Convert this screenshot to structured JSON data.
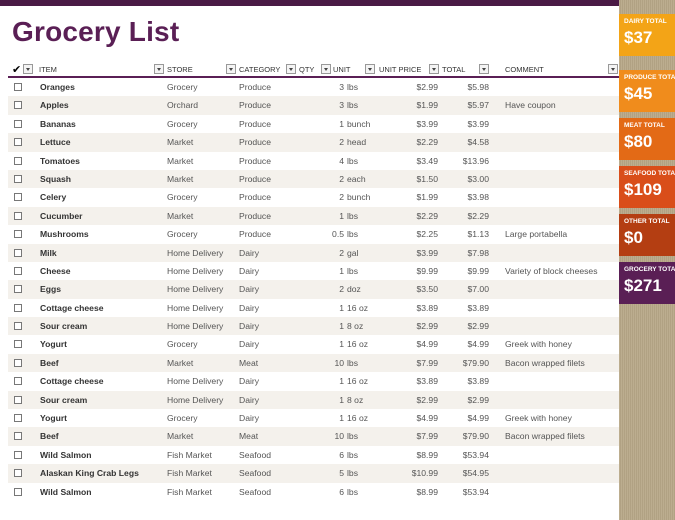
{
  "title": "Grocery List",
  "headers": {
    "check": "✔",
    "item": "ITEM",
    "store": "STORE",
    "category": "CATEGORY",
    "qty": "QTY",
    "unit": "UNIT",
    "unit_price": "UNIT PRICE",
    "total": "TOTAL",
    "comment": "COMMENT"
  },
  "rows": [
    {
      "item": "Oranges",
      "store": "Grocery",
      "category": "Produce",
      "qty": "3",
      "unit": "lbs",
      "price": "$2.99",
      "total": "$5.98",
      "comment": ""
    },
    {
      "item": "Apples",
      "store": "Orchard",
      "category": "Produce",
      "qty": "3",
      "unit": "lbs",
      "price": "$1.99",
      "total": "$5.97",
      "comment": "Have coupon"
    },
    {
      "item": "Bananas",
      "store": "Grocery",
      "category": "Produce",
      "qty": "1",
      "unit": "bunch",
      "price": "$3.99",
      "total": "$3.99",
      "comment": ""
    },
    {
      "item": "Lettuce",
      "store": "Market",
      "category": "Produce",
      "qty": "2",
      "unit": "head",
      "price": "$2.29",
      "total": "$4.58",
      "comment": ""
    },
    {
      "item": "Tomatoes",
      "store": "Market",
      "category": "Produce",
      "qty": "4",
      "unit": "lbs",
      "price": "$3.49",
      "total": "$13.96",
      "comment": ""
    },
    {
      "item": "Squash",
      "store": "Market",
      "category": "Produce",
      "qty": "2",
      "unit": "each",
      "price": "$1.50",
      "total": "$3.00",
      "comment": ""
    },
    {
      "item": "Celery",
      "store": "Grocery",
      "category": "Produce",
      "qty": "2",
      "unit": "bunch",
      "price": "$1.99",
      "total": "$3.98",
      "comment": ""
    },
    {
      "item": "Cucumber",
      "store": "Market",
      "category": "Produce",
      "qty": "1",
      "unit": "lbs",
      "price": "$2.29",
      "total": "$2.29",
      "comment": ""
    },
    {
      "item": "Mushrooms",
      "store": "Grocery",
      "category": "Produce",
      "qty": "0.5",
      "unit": "lbs",
      "price": "$2.25",
      "total": "$1.13",
      "comment": "Large portabella"
    },
    {
      "item": "Milk",
      "store": "Home Delivery",
      "category": "Dairy",
      "qty": "2",
      "unit": "gal",
      "price": "$3.99",
      "total": "$7.98",
      "comment": ""
    },
    {
      "item": "Cheese",
      "store": "Home Delivery",
      "category": "Dairy",
      "qty": "1",
      "unit": "lbs",
      "price": "$9.99",
      "total": "$9.99",
      "comment": "Variety of block cheeses"
    },
    {
      "item": "Eggs",
      "store": "Home Delivery",
      "category": "Dairy",
      "qty": "2",
      "unit": "doz",
      "price": "$3.50",
      "total": "$7.00",
      "comment": ""
    },
    {
      "item": "Cottage cheese",
      "store": "Home Delivery",
      "category": "Dairy",
      "qty": "1",
      "unit": "16 oz",
      "price": "$3.89",
      "total": "$3.89",
      "comment": ""
    },
    {
      "item": "Sour cream",
      "store": "Home Delivery",
      "category": "Dairy",
      "qty": "1",
      "unit": "8 oz",
      "price": "$2.99",
      "total": "$2.99",
      "comment": ""
    },
    {
      "item": "Yogurt",
      "store": "Grocery",
      "category": "Dairy",
      "qty": "1",
      "unit": "16 oz",
      "price": "$4.99",
      "total": "$4.99",
      "comment": "Greek with honey"
    },
    {
      "item": "Beef",
      "store": "Market",
      "category": "Meat",
      "qty": "10",
      "unit": "lbs",
      "price": "$7.99",
      "total": "$79.90",
      "comment": "Bacon wrapped filets"
    },
    {
      "item": "Cottage cheese",
      "store": "Home Delivery",
      "category": "Dairy",
      "qty": "1",
      "unit": "16 oz",
      "price": "$3.89",
      "total": "$3.89",
      "comment": ""
    },
    {
      "item": "Sour cream",
      "store": "Home Delivery",
      "category": "Dairy",
      "qty": "1",
      "unit": "8 oz",
      "price": "$2.99",
      "total": "$2.99",
      "comment": ""
    },
    {
      "item": "Yogurt",
      "store": "Grocery",
      "category": "Dairy",
      "qty": "1",
      "unit": "16 oz",
      "price": "$4.99",
      "total": "$4.99",
      "comment": "Greek with honey"
    },
    {
      "item": "Beef",
      "store": "Market",
      "category": "Meat",
      "qty": "10",
      "unit": "lbs",
      "price": "$7.99",
      "total": "$79.90",
      "comment": "Bacon wrapped filets"
    },
    {
      "item": "Wild Salmon",
      "store": "Fish Market",
      "category": "Seafood",
      "qty": "6",
      "unit": "lbs",
      "price": "$8.99",
      "total": "$53.94",
      "comment": ""
    },
    {
      "item": "Alaskan King Crab Legs",
      "store": "Fish Market",
      "category": "Seafood",
      "qty": "5",
      "unit": "lbs",
      "price": "$10.99",
      "total": "$54.95",
      "comment": ""
    },
    {
      "item": "Wild Salmon",
      "store": "Fish Market",
      "category": "Seafood",
      "qty": "6",
      "unit": "lbs",
      "price": "$8.99",
      "total": "$53.94",
      "comment": ""
    }
  ],
  "totals": [
    {
      "label": "DAIRY TOTAL",
      "amount": "$37",
      "color": "#f3a417"
    },
    {
      "label": "PRODUCE TOTAL",
      "amount": "$45",
      "color": "#f08c1c"
    },
    {
      "label": "MEAT TOTAL",
      "amount": "$80",
      "color": "#e36a16"
    },
    {
      "label": "SEAFOOD TOTAL",
      "amount": "$109",
      "color": "#d94e1a"
    },
    {
      "label": "OTHER TOTAL",
      "amount": "$0",
      "color": "#b43e12"
    },
    {
      "label": "GROCERY TOTAL",
      "amount": "$271",
      "color": "#5a1f55"
    }
  ]
}
